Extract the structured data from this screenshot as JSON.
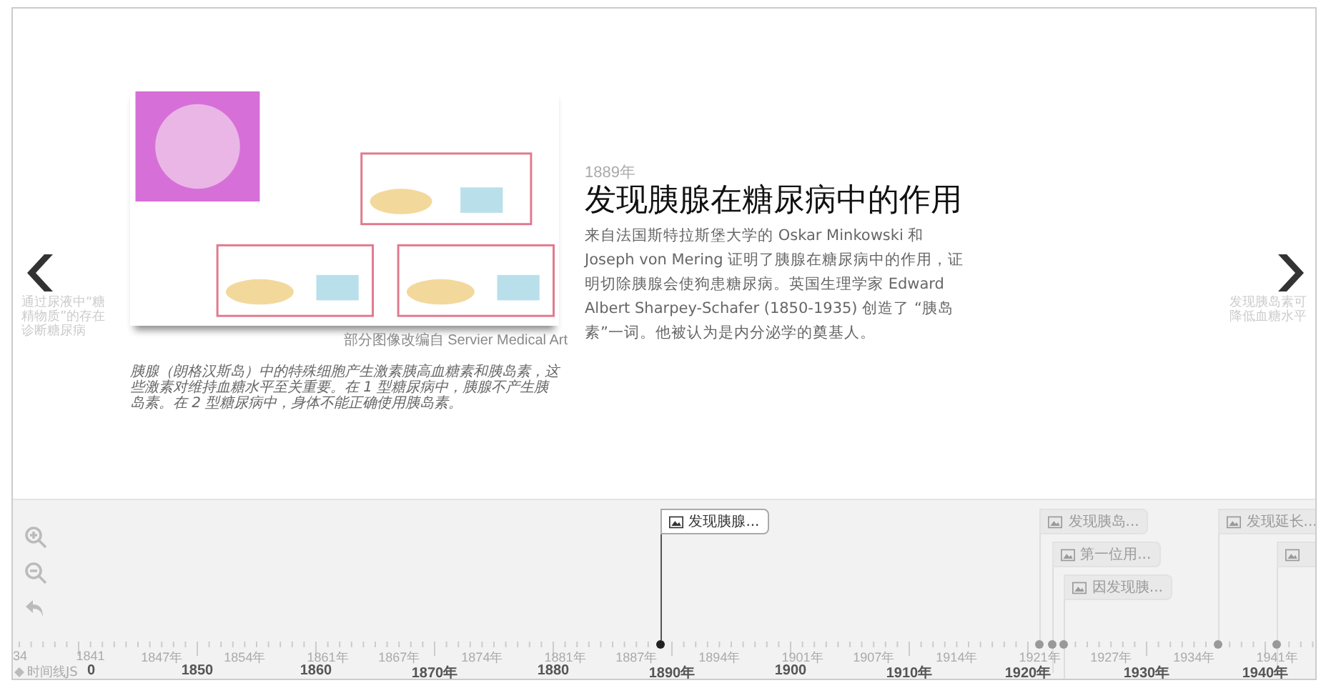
{
  "slide": {
    "prev": {
      "label": "通过尿液中“糖精物质”的存在诊断糖尿病"
    },
    "next": {
      "label": "发现胰岛素可降低血糖水平"
    },
    "media": {
      "credit": "部分图像改编自 Servier Medical Art",
      "caption": "胰腺（朗格汉斯岛）中的特殊细胞产生激素胰高血糖素和胰岛素，这些激素对维持血糖水平至关重要。在 1 型糖尿病中，胰腺不产生胰岛素。在 2 型糖尿病中，身体不能正确使用胰岛素。"
    },
    "date": "1889年",
    "headline": "发现胰腺在糖尿病中的作用",
    "text": "来自法国斯特拉斯堡大学的 Oskar Minkowski 和 Joseph von Mering 证明了胰腺在糖尿病中的作用，证明切除胰腺会使狗患糖尿病。英国生理学家 Edward Albert Sharpey-Schafer (1850-1935) 创造了 “胰岛素”一词。他被认为是内分泌学的奠基人。"
  },
  "timeline": {
    "brand": "时间线JS",
    "events": [
      {
        "title": "发现胰腺...",
        "selected": true
      },
      {
        "title": "发现胰岛...",
        "selected": false
      },
      {
        "title": "第一位用...",
        "selected": false
      },
      {
        "title": "因发现胰...",
        "selected": false
      },
      {
        "title": "发现延长...",
        "selected": false
      },
      {
        "selected": false
      }
    ],
    "minor_labels": [
      "34",
      "1841",
      "1847年",
      "1854年",
      "1861年",
      "1867年",
      "1874年",
      "1881年",
      "1887年",
      "1894年",
      "1901年",
      "1907年",
      "1914年",
      "1921年",
      "1927年",
      "1934年",
      "1941年"
    ],
    "major_labels": [
      "0",
      "1850",
      "1860",
      "1870年",
      "1880",
      "1890年",
      "1900",
      "1910年",
      "1920年",
      "1930年",
      "1940年"
    ]
  }
}
